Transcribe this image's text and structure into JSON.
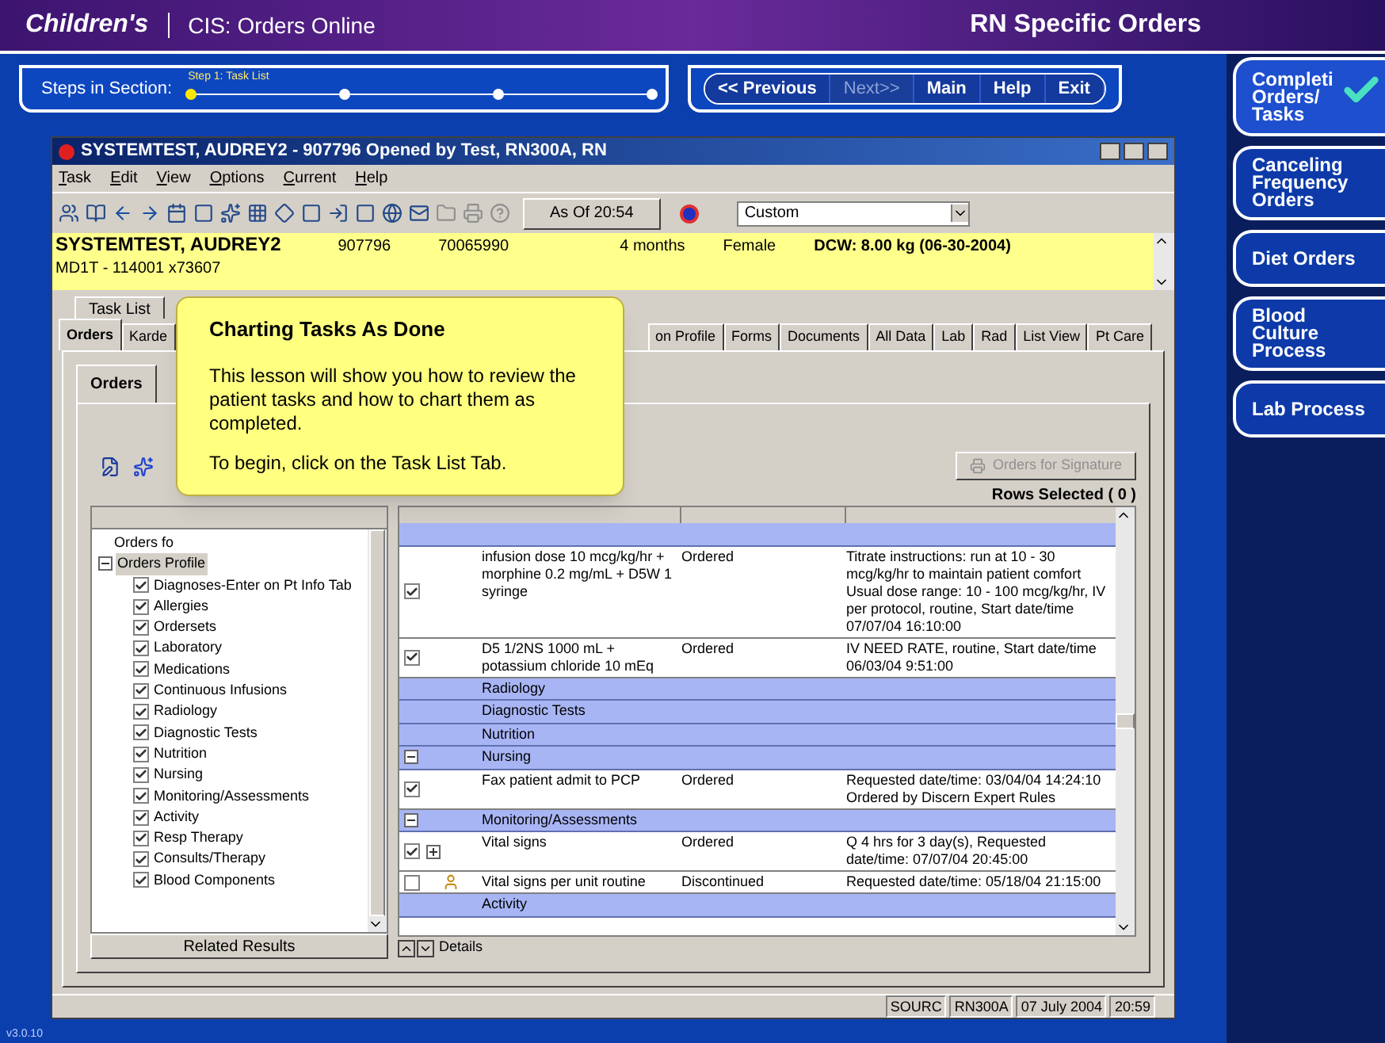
{
  "header": {
    "logo": "Children's",
    "app_title": "CIS: Orders Online",
    "section_title": "RN Specific Orders"
  },
  "steps": {
    "label": "Steps in Section:",
    "items": [
      {
        "label": "Step 1: Task List",
        "selected": true
      },
      {
        "selected": false
      },
      {
        "selected": false
      },
      {
        "selected": false
      }
    ]
  },
  "nav_buttons": [
    {
      "label": "<< Previous",
      "disabled": false
    },
    {
      "label": "Next>>",
      "disabled": true
    },
    {
      "label": "Main",
      "disabled": false
    },
    {
      "label": "Help",
      "disabled": false
    },
    {
      "label": "Exit",
      "disabled": false
    }
  ],
  "side_tabs": [
    {
      "label": "Completi Orders/ Tasks",
      "selected": true
    },
    {
      "label": "Canceling Frequency Orders",
      "selected": false
    },
    {
      "label": "Diet Orders",
      "selected": false
    },
    {
      "label": "Blood Culture Process",
      "selected": false
    },
    {
      "label": "Lab Process",
      "selected": false
    }
  ],
  "window": {
    "title": "SYSTEMTEST, AUDREY2 - 907796 Opened by Test, RN300A, RN",
    "menu": [
      "Task",
      "Edit",
      "View",
      "Options",
      "Current",
      "Help"
    ],
    "as_of": "As Of 20:54",
    "view_select": "Custom"
  },
  "banner": {
    "name": "SYSTEMTEST, AUDREY2",
    "mrn": "907796",
    "fin": "70065990",
    "age": "4 months",
    "sex": "Female",
    "weight": "DCW: 8.00 kg (06-30-2004)",
    "location": "MD1T - 114001 x73607"
  },
  "top_tabs": [
    {
      "label": "Task List",
      "selected": false
    }
  ],
  "tabs": [
    {
      "label": "Orders",
      "selected": true
    },
    {
      "label": "Karde",
      "selected": false
    },
    {
      "label": "on Profile",
      "selected": false
    },
    {
      "label": "Forms",
      "selected": false
    },
    {
      "label": "Documents",
      "selected": false
    },
    {
      "label": "All Data",
      "selected": false
    },
    {
      "label": "Lab",
      "selected": false
    },
    {
      "label": "Rad",
      "selected": false
    },
    {
      "label": "List View",
      "selected": false
    },
    {
      "label": "Pt Care",
      "selected": false
    }
  ],
  "inner_tab": {
    "label": "Orders",
    "selected": true
  },
  "orders_for_signature": {
    "label": "Orders for Signature",
    "disabled": true
  },
  "rows_selected": "Rows Selected ( 0 )",
  "tree": {
    "root": {
      "label": "Orders fo",
      "selected": false
    },
    "profile": {
      "label": "Orders Profile",
      "selected": true,
      "expanded": true,
      "children": [
        {
          "label": "Diagnoses-Enter on Pt Info Tab",
          "checked": true,
          "selected": false
        },
        {
          "label": "Allergies",
          "checked": true,
          "selected": false
        },
        {
          "label": "Ordersets",
          "checked": true,
          "selected": false
        },
        {
          "label": "Laboratory",
          "checked": true,
          "selected": false
        },
        {
          "label": "Medications",
          "checked": true,
          "selected": false
        },
        {
          "label": "Continuous Infusions",
          "checked": true,
          "selected": false
        },
        {
          "label": "Radiology",
          "checked": true,
          "selected": false
        },
        {
          "label": "Diagnostic Tests",
          "checked": true,
          "selected": false
        },
        {
          "label": "Nutrition",
          "checked": true,
          "selected": false
        },
        {
          "label": "Nursing",
          "checked": true,
          "selected": false
        },
        {
          "label": "Monitoring/Assessments",
          "checked": true,
          "selected": false
        },
        {
          "label": "Activity",
          "checked": true,
          "selected": false
        },
        {
          "label": "Resp Therapy",
          "checked": true,
          "selected": false
        },
        {
          "label": "Consults/Therapy",
          "checked": true,
          "selected": false
        },
        {
          "label": "Blood Components",
          "checked": true,
          "selected": false
        }
      ]
    }
  },
  "related_results": "Related Results",
  "grid": {
    "rows": [
      {
        "kind": "group",
        "label": "",
        "expanded": false
      },
      {
        "kind": "order",
        "checked": true,
        "has_children": false,
        "discontinued": false,
        "name": "infusion dose 10 mcg/kg/hr + morphine 0.2 mg/mL + D5W 1 syringe",
        "status": "Ordered",
        "details": "Titrate instructions: run at 10 - 30 mcg/kg/hr to maintain patient comfort Usual dose range: 10 - 100 mcg/kg/hr, IV per protocol, routine, Start date/time 07/07/04 16:10:00"
      },
      {
        "kind": "order",
        "checked": true,
        "has_children": false,
        "discontinued": false,
        "name": "D5 1/2NS 1000 mL + potassium chloride 10 mEq",
        "status": "Ordered",
        "details": "IV NEED RATE, routine, Start date/time 06/03/04 9:51:00"
      },
      {
        "kind": "group",
        "label": "Radiology",
        "expanded": false
      },
      {
        "kind": "group",
        "label": "Diagnostic Tests",
        "expanded": false
      },
      {
        "kind": "group",
        "label": "Nutrition",
        "expanded": false
      },
      {
        "kind": "group",
        "label": "Nursing",
        "expanded": true
      },
      {
        "kind": "order",
        "checked": true,
        "has_children": false,
        "discontinued": false,
        "name": "Fax patient admit to PCP",
        "status": "Ordered",
        "details": "Requested date/time: 03/04/04 14:24:10 Ordered by Discern Expert Rules"
      },
      {
        "kind": "group",
        "label": "Monitoring/Assessments",
        "expanded": true
      },
      {
        "kind": "order",
        "checked": true,
        "has_children": true,
        "discontinued": false,
        "name": "Vital signs",
        "status": "Ordered",
        "details": "Q 4 hrs for 3 day(s), Requested date/time: 07/07/04 20:45:00"
      },
      {
        "kind": "order",
        "checked": false,
        "has_children": false,
        "discontinued": true,
        "name": "Vital signs per unit routine",
        "status": "Discontinued",
        "details": "Requested date/time: 05/18/04 21:15:00"
      },
      {
        "kind": "group",
        "label": "Activity",
        "expanded": false
      }
    ]
  },
  "details": "Details",
  "status_bar": [
    "SOURC",
    "RN300A",
    "07 July 2004",
    "20:59"
  ],
  "callout": {
    "title": "Charting Tasks As Done",
    "paragraphs": [
      "This lesson will show you how to review the patient tasks and how to chart them as completed.",
      "To begin, click on the Task List Tab."
    ]
  },
  "version": "v3.0.10"
}
